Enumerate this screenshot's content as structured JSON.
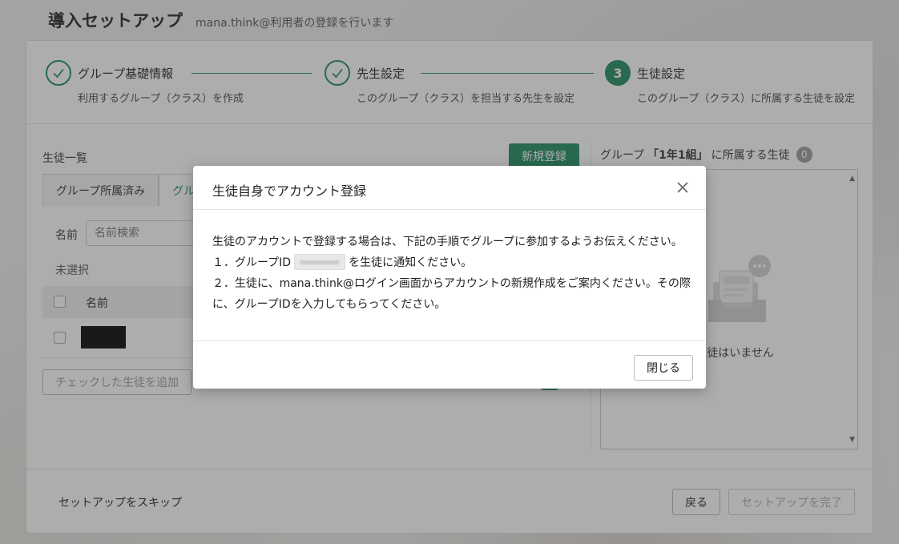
{
  "header": {
    "title": "導入セットアップ",
    "subtitle": "mana.think@利用者の登録を行います"
  },
  "stepper": {
    "steps": [
      {
        "title": "グループ基礎情報",
        "description": "利用するグループ（クラス）を作成",
        "state": "done",
        "icon": "check-icon"
      },
      {
        "title": "先生設定",
        "description": "このグループ（クラス）を担当する先生を設定",
        "state": "done",
        "icon": "check-icon"
      },
      {
        "number": "3",
        "title": "生徒設定",
        "description": "このグループ（クラス）に所属する生徒を設定",
        "state": "active"
      }
    ]
  },
  "student_list": {
    "title": "生徒一覧",
    "new_button": "新規登録",
    "tabs": [
      {
        "label": "グループ所属済み"
      },
      {
        "label": "グル"
      }
    ],
    "filter_label": "名前",
    "search_placeholder": "名前検索",
    "unselected_label": "未選択",
    "column_name": "名前",
    "add_checked_button": "チェックした生徒を追加"
  },
  "group_members": {
    "title_prefix": "グループ",
    "group_name": "「1年1組」",
    "title_suffix": "に所属する生徒",
    "count": "0",
    "empty_text": "る生徒はいません"
  },
  "footer": {
    "skip_label": "セットアップをスキップ",
    "back_button": "戻る",
    "complete_button": "セットアップを完了"
  },
  "modal": {
    "title": "生徒自身でアカウント登録",
    "line1": "生徒のアカウントで登録する場合は、下記の手順でグループに参加するようお伝えください。",
    "line2_prefix": "１．グループID",
    "line2_suffix": "を生徒に通知ください。",
    "line3": "２．生徒に、mana.think@ログイン画面からアカウントの新規作成をご案内ください。その際",
    "line4": "に、グループIDを入力してもらってください。",
    "close_button": "閉じる"
  },
  "colors": {
    "accent": "#1c8a5f",
    "overlay": "rgba(60,60,60,0.42)"
  }
}
